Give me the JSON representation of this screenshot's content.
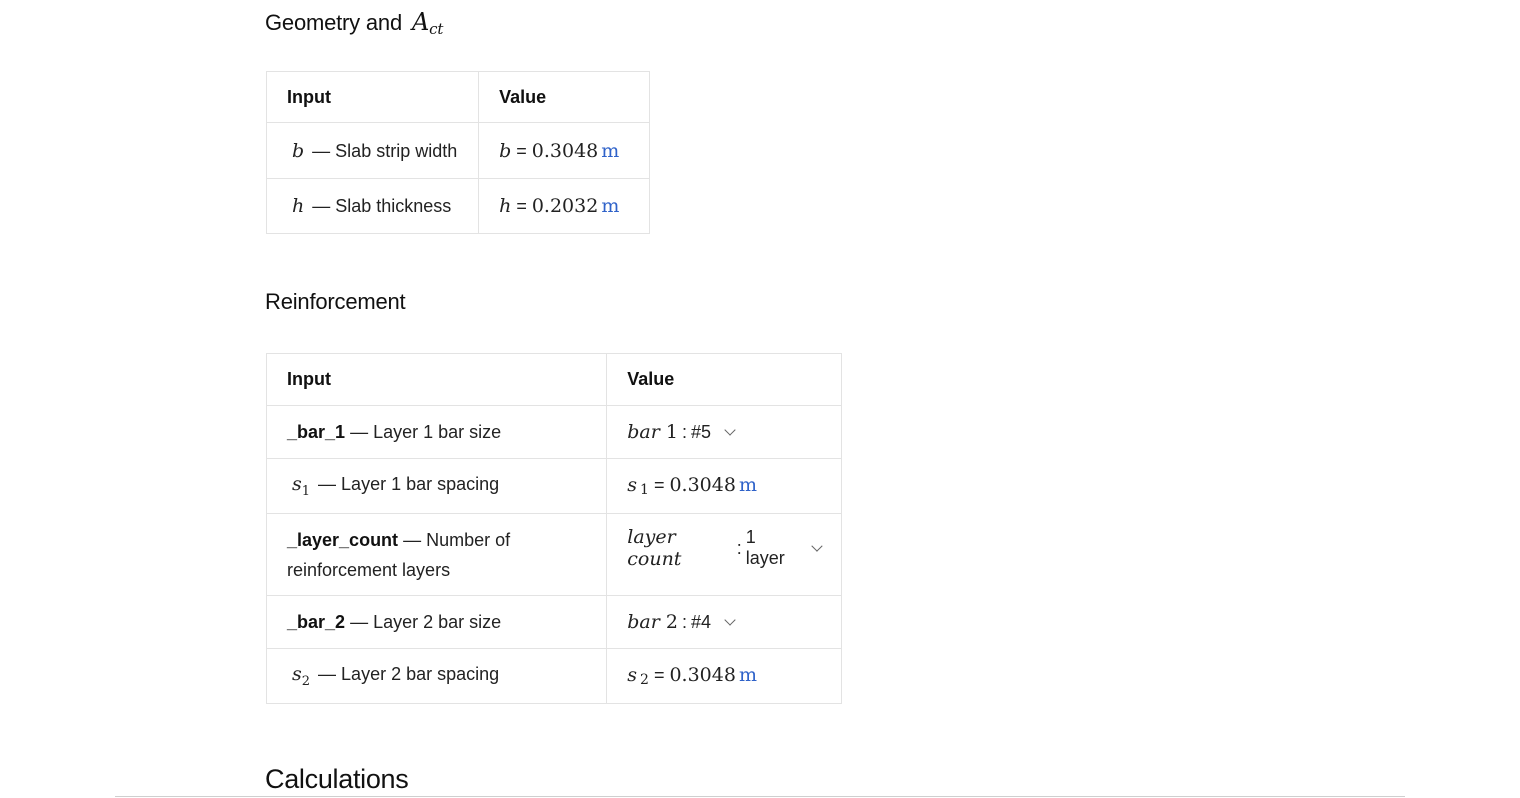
{
  "geometry": {
    "heading_text": "Geometry and",
    "heading_math_base": "A",
    "heading_math_sub": "ct",
    "columns": {
      "input": "Input",
      "value": "Value"
    },
    "rows": [
      {
        "symbol": "b",
        "description": "— Slab strip width",
        "value_symbol": "b",
        "value": "0.3048",
        "unit": "m"
      },
      {
        "symbol": "h",
        "description": "— Slab thickness",
        "value_symbol": "h",
        "value": "0.2032",
        "unit": "m"
      }
    ]
  },
  "reinforcement": {
    "heading": "Reinforcement",
    "columns": {
      "input": "Input",
      "value": "Value"
    },
    "rows": [
      {
        "code": "_bar_1",
        "description": "— Layer 1 bar size",
        "select_label": "bar",
        "select_index": "1",
        "select_value": "#5"
      },
      {
        "symbol": "s",
        "symbol_sub": "1",
        "description": "— Layer 1 bar spacing",
        "value_symbol": "s",
        "value_sub": "1",
        "value": "0.3048",
        "unit": "m"
      },
      {
        "code": "_layer_count",
        "description_line1": "— Number of",
        "description_line2": "reinforcement layers",
        "select_label": "layer count",
        "select_value": "1 layer"
      },
      {
        "code": "_bar_2",
        "description": "— Layer 2 bar size",
        "select_label": "bar",
        "select_index": "2",
        "select_value": "#4"
      },
      {
        "symbol": "s",
        "symbol_sub": "2",
        "description": "— Layer 2 bar spacing",
        "value_symbol": "s",
        "value_sub": "2",
        "value": "0.3048",
        "unit": "m"
      }
    ]
  },
  "calculations": {
    "heading": "Calculations"
  }
}
